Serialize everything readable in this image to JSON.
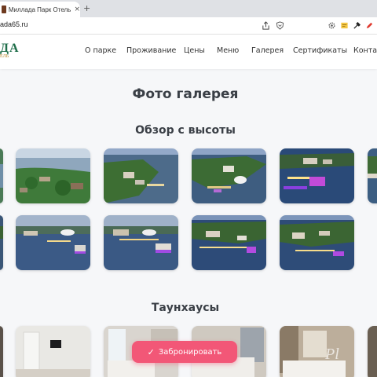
{
  "browser": {
    "tab_title": "Миллада Парк Отель. Полно",
    "tab_close": "×",
    "new_tab": "+",
    "url": "ada65.ru"
  },
  "site": {
    "logo_text": "ДА",
    "logo_sub": "ЕЛЬ",
    "logo_color": "#1f6e4a",
    "nav": [
      "О парке",
      "Проживание",
      "Цены",
      "Меню",
      "Галерея",
      "Сертификаты",
      "Контакты"
    ]
  },
  "gallery": {
    "title": "Фото галерея",
    "sections": [
      {
        "title": "Обзор с высоты"
      },
      {
        "title": "Таунхаусы"
      }
    ]
  },
  "booking": {
    "check_icon": "check-icon",
    "label": "Забронировать",
    "color": "#f25777"
  }
}
